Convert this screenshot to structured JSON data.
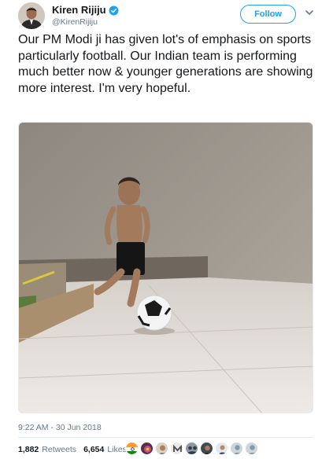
{
  "tweet": {
    "author": {
      "display_name": "Kiren Rijiju",
      "handle": "@KirenRijiju",
      "verified": true
    },
    "follow_label": "Follow",
    "text": "Our PM Modi ji has given lot's of emphasis on sports particularly football. Our Indian team is performing much better now & younger generations are showing more interest. I'm very hopeful.",
    "timestamp": "9:22 AM - 30 Jun 2018",
    "stats": {
      "retweets_count": "1,882",
      "retweets_label": "Retweets",
      "likes_count": "6,654",
      "likes_label": "Likes"
    },
    "likers": [
      {
        "icon": "india-flag-avatar"
      },
      {
        "icon": "flower-avatar"
      },
      {
        "icon": "person-avatar"
      },
      {
        "icon": "logo-avatar"
      },
      {
        "icon": "group-avatar"
      },
      {
        "icon": "person-dark-avatar"
      },
      {
        "icon": "flag-avatar"
      },
      {
        "icon": "default-avatar"
      },
      {
        "icon": "default-avatar"
      }
    ]
  },
  "colors": {
    "accent": "#1da1f2",
    "text_primary": "#14171a",
    "text_secondary": "#657786",
    "divider": "#e6ecf0"
  }
}
